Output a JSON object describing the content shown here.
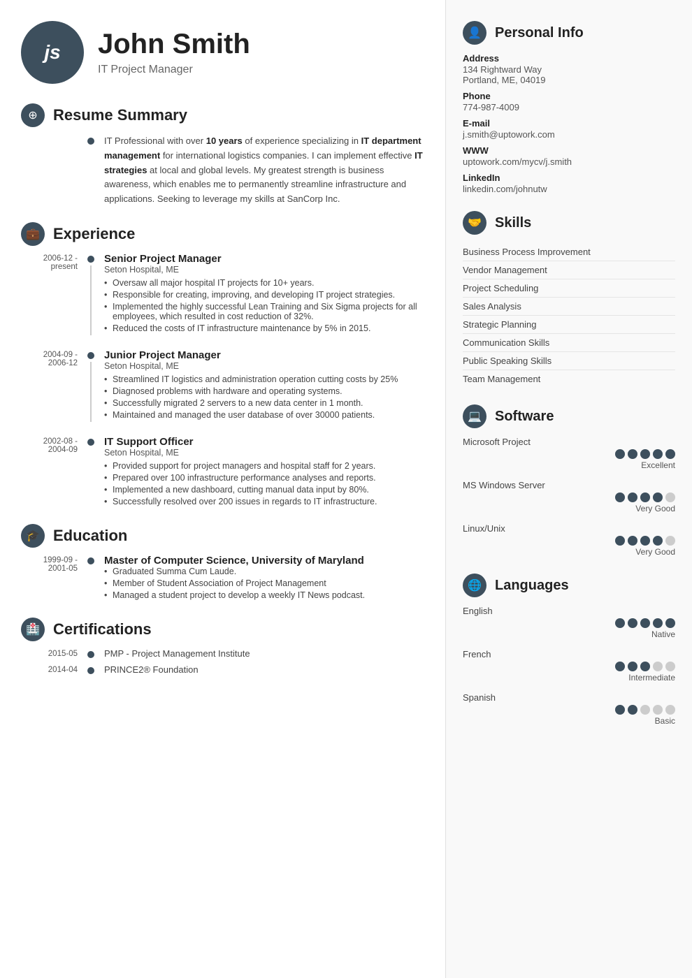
{
  "header": {
    "initials": "js",
    "name": "John Smith",
    "title": "IT Project Manager"
  },
  "summary": {
    "section_title": "Resume Summary",
    "text_before": "IT Professional with over ",
    "bold1": "10 years",
    "text2": " of experience specializing in ",
    "bold2": "IT department management",
    "text3": " for international logistics companies. I can implement effective ",
    "bold3": "IT strategies",
    "text4": " at local and global levels. My greatest strength is business awareness, which enables me to permanently streamline infrastructure and applications. Seeking to leverage my skills at SanCorp Inc."
  },
  "experience": {
    "section_title": "Experience",
    "jobs": [
      {
        "date": "2006-12 - present",
        "title": "Senior Project Manager",
        "company": "Seton Hospital, ME",
        "bullets": [
          "Oversaw all major hospital IT projects for 10+ years.",
          "Responsible for creating, improving, and developing IT project strategies.",
          "Implemented the highly successful Lean Training and Six Sigma projects for all employees, which resulted in cost reduction of 32%.",
          "Reduced the costs of IT infrastructure maintenance by 5% in 2015."
        ]
      },
      {
        "date": "2004-09 - 2006-12",
        "title": "Junior Project Manager",
        "company": "Seton Hospital, ME",
        "bullets": [
          "Streamlined IT logistics and administration operation cutting costs by 25%",
          "Diagnosed problems with hardware and operating systems.",
          "Successfully migrated 2 servers to a new data center in 1 month.",
          "Maintained and managed the user database of over 30000 patients."
        ]
      },
      {
        "date": "2002-08 - 2004-09",
        "title": "IT Support Officer",
        "company": "Seton Hospital, ME",
        "bullets": [
          "Provided support for project managers and hospital staff for 2 years.",
          "Prepared over 100 infrastructure performance analyses and reports.",
          "Implemented a new dashboard, cutting manual data input by 80%.",
          "Successfully resolved over 200 issues in regards to IT infrastructure."
        ]
      }
    ]
  },
  "education": {
    "section_title": "Education",
    "items": [
      {
        "date": "1999-09 - 2001-05",
        "degree": "Master of Computer Science, University of Maryland",
        "bullets": [
          "Graduated Summa Cum Laude.",
          "Member of Student Association of Project Management",
          "Managed a student project to develop a weekly IT News podcast."
        ]
      }
    ]
  },
  "certifications": {
    "section_title": "Certifications",
    "items": [
      {
        "date": "2015-05",
        "text": "PMP - Project Management Institute"
      },
      {
        "date": "2014-04",
        "text": "PRINCE2® Foundation"
      }
    ]
  },
  "personal_info": {
    "section_title": "Personal Info",
    "fields": [
      {
        "label": "Address",
        "value": "134 Rightward Way\nPortland, ME, 04019"
      },
      {
        "label": "Phone",
        "value": "774-987-4009"
      },
      {
        "label": "E-mail",
        "value": "j.smith@uptowork.com"
      },
      {
        "label": "WWW",
        "value": "uptowork.com/mycv/j.smith"
      },
      {
        "label": "LinkedIn",
        "value": "linkedin.com/johnutw"
      }
    ]
  },
  "skills": {
    "section_title": "Skills",
    "items": [
      "Business Process Improvement",
      "Vendor Management",
      "Project Scheduling",
      "Sales Analysis",
      "Strategic Planning",
      "Communication Skills",
      "Public Speaking Skills",
      "Team Management"
    ]
  },
  "software": {
    "section_title": "Software",
    "items": [
      {
        "name": "Microsoft Project",
        "filled": 5,
        "total": 5,
        "label": "Excellent"
      },
      {
        "name": "MS Windows Server",
        "filled": 4,
        "total": 5,
        "label": "Very Good"
      },
      {
        "name": "Linux/Unix",
        "filled": 4,
        "total": 5,
        "label": "Very Good"
      }
    ]
  },
  "languages": {
    "section_title": "Languages",
    "items": [
      {
        "name": "English",
        "filled": 5,
        "total": 5,
        "label": "Native"
      },
      {
        "name": "French",
        "filled": 3,
        "total": 5,
        "label": "Intermediate"
      },
      {
        "name": "Spanish",
        "filled": 2,
        "total": 5,
        "label": "Basic"
      }
    ]
  },
  "icons": {
    "summary": "⊕",
    "experience": "💼",
    "education": "🎓",
    "certifications": "🏅",
    "personal": "👤",
    "skills": "🤝",
    "software": "💻",
    "languages": "🌐"
  }
}
